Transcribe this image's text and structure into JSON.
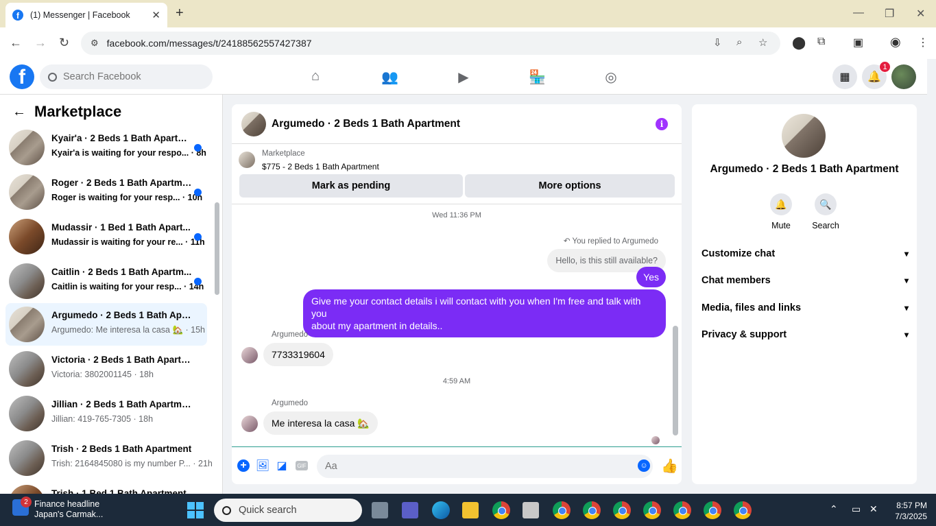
{
  "browser": {
    "tab_title": "(1) Messenger | Facebook",
    "url": "facebook.com/messages/t/24188562557427387"
  },
  "fb": {
    "search_placeholder": "Search Facebook",
    "notif_count": "1"
  },
  "sidebar": {
    "title": "Marketplace",
    "conversations": [
      {
        "name": "Kyair'a · 2 Beds 1 Bath Apartm...",
        "preview": "Kyair'a is waiting for your respo... · 8h",
        "unread": true
      },
      {
        "name": "Roger · 2 Beds 1 Bath Apartme...",
        "preview": "Roger is waiting for your resp... · 10h",
        "unread": true
      },
      {
        "name": "Mudassir · 1 Bed 1 Bath Apart...",
        "preview": "Mudassir is waiting for your re... · 11h",
        "unread": true
      },
      {
        "name": "Caitlin · 2 Beds 1 Bath Apartm...",
        "preview": "Caitlin is waiting for your resp... · 14h",
        "unread": true
      },
      {
        "name": "Argumedo · 2 Beds 1 Bath Apart...",
        "preview": "Argumedo: Me interesa la casa 🏡 · 15h",
        "unread": false
      },
      {
        "name": "Victoria · 2 Beds 1 Bath Apartme...",
        "preview": "Victoria: 3802001145 · 18h",
        "unread": false
      },
      {
        "name": "Jillian · 2 Beds 1 Bath Apartment",
        "preview": "Jillian: 419-765-7305 · 18h",
        "unread": false
      },
      {
        "name": "Trish · 2 Beds 1 Bath Apartment",
        "preview": "Trish: 2164845080 is my number P... · 21h",
        "unread": false
      },
      {
        "name": "Trish · 1 Bed 1 Bath Apartment",
        "preview": "",
        "unread": false
      }
    ]
  },
  "chat": {
    "title": "Argumedo · 2 Beds 1 Bath Apartment",
    "listing_source": "Marketplace",
    "listing_desc": "$775 - 2 Beds 1 Bath Apartment",
    "mark_pending": "Mark as pending",
    "more_options": "More options",
    "ts1": "Wed 11:36 PM",
    "replied_note": "You replied to Argumedo",
    "quoted": "Hello, is this still available?",
    "msg_yes": "Yes",
    "msg_long_1": "Give me your contact details i will contact with you when I'm free and talk with you",
    "msg_long_2": "about my apartment in details..",
    "sender1": "Argumedo",
    "msg_phone": "7733319604",
    "ts2": "4:59 AM",
    "sender2": "Argumedo",
    "msg_casa": "Me interesa la casa 🏡",
    "composer_placeholder": "Aa",
    "gif": "GIF"
  },
  "details": {
    "title": "Argumedo · 2 Beds 1 Bath Apartment",
    "mute": "Mute",
    "search": "Search",
    "sections": [
      "Customize chat",
      "Chat members",
      "Media, files and links",
      "Privacy & support"
    ]
  },
  "taskbar": {
    "news_title": "Finance headline",
    "news_sub": "Japan's Carmak...",
    "news_badge": "2",
    "search": "Quick search",
    "time": "8:57 PM",
    "date": "7/3/2025"
  }
}
